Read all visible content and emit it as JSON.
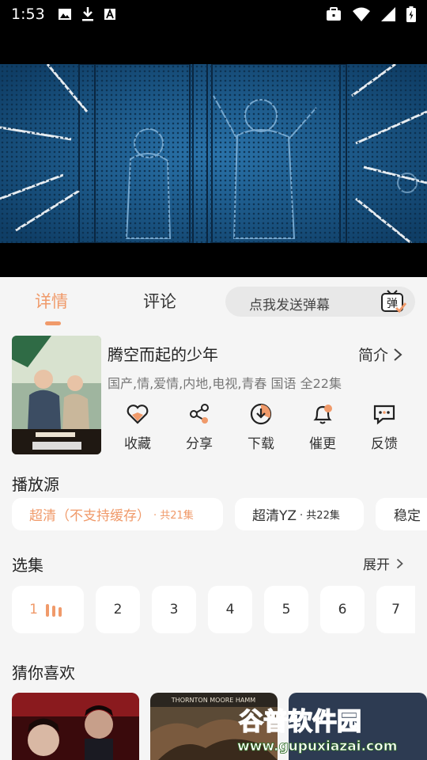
{
  "status_bar": {
    "time": "1:53",
    "left_icons": [
      "image-icon",
      "download-icon",
      "a-box-icon"
    ],
    "right_icons": [
      "briefcase-icon",
      "wifi-icon",
      "signal-icon",
      "battery-icon"
    ]
  },
  "tabs": {
    "details": "详情",
    "comments": "评论",
    "active": "details",
    "accent_color": "#f09a6a"
  },
  "danmu": {
    "placeholder": "点我发送弹幕",
    "button_char": "弹"
  },
  "show": {
    "title": "腾空而起的少年",
    "intro_label": "简介",
    "tags": "国产,情,爱情,内地,电视,青春 国语 全22集"
  },
  "actions": [
    {
      "label": "收藏",
      "icon": "heart-icon"
    },
    {
      "label": "分享",
      "icon": "share-icon"
    },
    {
      "label": "下载",
      "icon": "download-icon"
    },
    {
      "label": "催更",
      "icon": "bell-icon"
    },
    {
      "label": "反馈",
      "icon": "feedback-icon"
    }
  ],
  "sources": {
    "title": "播放源",
    "items": [
      {
        "name": "超清（不支持缓存）",
        "count": "· 共21集",
        "active": true
      },
      {
        "name": "超清YZ",
        "count": "· 共22集",
        "active": false
      },
      {
        "name": "稳定",
        "count": "",
        "active": false
      }
    ]
  },
  "episodes": {
    "title": "选集",
    "expand_label": "展开",
    "items": [
      "1",
      "2",
      "3",
      "4",
      "5",
      "6",
      "7"
    ],
    "playing": "1"
  },
  "recommend": {
    "title": "猜你喜欢",
    "posters": [
      {
        "text": ""
      },
      {
        "text": "THORNTON   MOORE   HAMM"
      }
    ]
  },
  "watermark": {
    "line1": "谷普软件园",
    "line2": "www.gupuxiazai.com"
  }
}
